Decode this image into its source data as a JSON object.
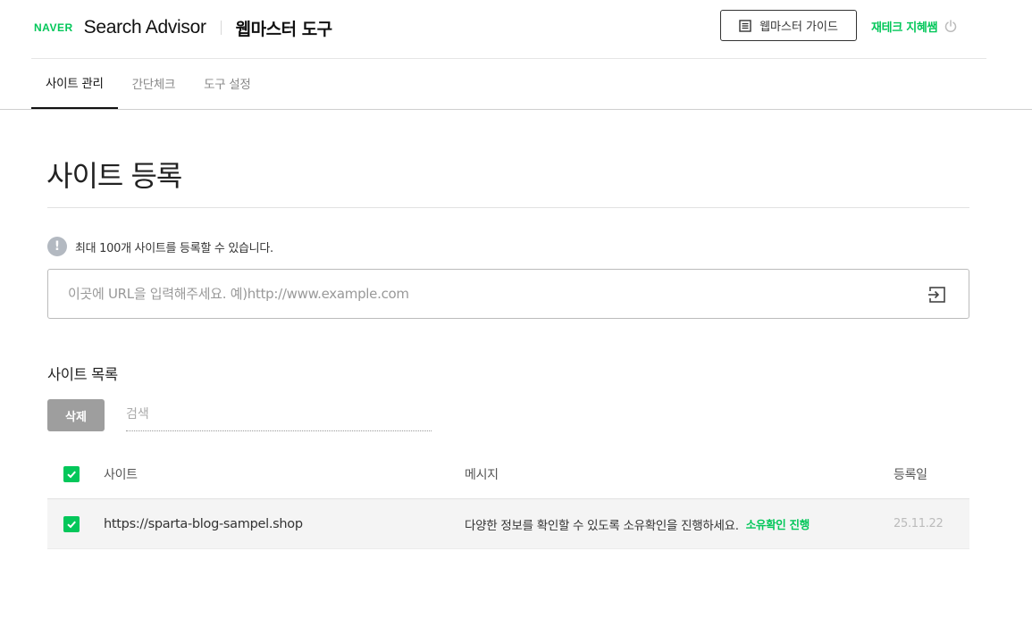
{
  "header": {
    "naver_logo": "NAVER",
    "product_name": "Search Advisor",
    "tool_name": "웹마스터 도구",
    "guide_button": "웹마스터 가이드",
    "user_name": "재테크 지혜쌤"
  },
  "tabs": [
    {
      "label": "사이트 관리",
      "active": true
    },
    {
      "label": "간단체크",
      "active": false
    },
    {
      "label": "도구 설정",
      "active": false
    }
  ],
  "main": {
    "title": "사이트 등록",
    "notice": "최대 100개 사이트를 등록할 수 있습니다.",
    "url_placeholder": "이곳에 URL을 입력해주세요. 예)http://www.example.com",
    "list_title": "사이트 목록",
    "delete_button": "삭제",
    "search_placeholder": "검색"
  },
  "table": {
    "headers": {
      "site": "사이트",
      "message": "메시지",
      "date": "등록일"
    },
    "rows": [
      {
        "checked": true,
        "site": "https://sparta-blog-sampel.shop",
        "message": "다양한 정보를 확인할 수 있도록 소유확인을 진행하세요.",
        "action": "소유확인 진행",
        "date": "25.11.22"
      }
    ]
  },
  "colors": {
    "brand_green": "#03c75a",
    "delete_button_gray": "#9e9e9e"
  },
  "icons": [
    "list-icon",
    "power-icon",
    "info-icon",
    "submit-arrow-icon",
    "check-icon"
  ]
}
